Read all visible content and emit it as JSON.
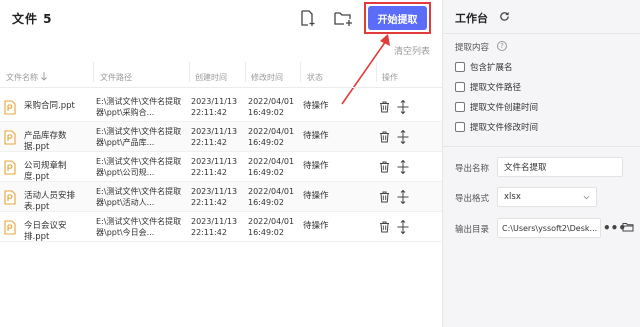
{
  "header": {
    "title": "文件 5",
    "start_button": "开始提取",
    "clear_list": "清空列表",
    "icons": [
      "add-file-icon",
      "add-folder-icon"
    ],
    "accent_color": "#5b6cf9",
    "highlight_color": "#e23b3b"
  },
  "table": {
    "columns": [
      "文件名称",
      "文件路径",
      "创建时间",
      "修改时间",
      "状态",
      "操作"
    ],
    "rows": [
      {
        "name": "采购合同.ppt",
        "path": "E:\\测试文件\\文件名提取器\\ppt\\采购合...",
        "created": "2023/11/13 22:11:42",
        "modified": "2022/04/01 16:49:02",
        "status": "待操作"
      },
      {
        "name": "产品库存数据.ppt",
        "path": "E:\\测试文件\\文件名提取器\\ppt\\产品库...",
        "created": "2023/11/13 22:11:42",
        "modified": "2022/04/01 16:49:02",
        "status": "待操作"
      },
      {
        "name": "公司规章制度.ppt",
        "path": "E:\\测试文件\\文件名提取器\\ppt\\公司规...",
        "created": "2023/11/13 22:11:42",
        "modified": "2022/04/01 16:49:02",
        "status": "待操作"
      },
      {
        "name": "活动人员安排表.ppt",
        "path": "E:\\测试文件\\文件名提取器\\ppt\\活动人...",
        "created": "2023/11/13 22:11:42",
        "modified": "2022/04/01 16:49:02",
        "status": "待操作"
      },
      {
        "name": "今日会议安排.ppt",
        "path": "E:\\测试文件\\文件名提取器\\ppt\\今日会...",
        "created": "2023/11/13 22:11:42",
        "modified": "2022/04/01 16:49:02",
        "status": "待操作"
      }
    ]
  },
  "workbench": {
    "title": "工作台",
    "extract_label": "提取内容",
    "options": [
      "包含扩展名",
      "提取文件路径",
      "提取文件创建时间",
      "提取文件修改时间"
    ],
    "export_name_label": "导出名称",
    "export_name_value": "文件名提取",
    "export_format_label": "导出格式",
    "export_format_value": "xlsx",
    "output_dir_label": "输出目录",
    "output_dir_value": "C:\\Users\\yssoft2\\Desk..."
  }
}
